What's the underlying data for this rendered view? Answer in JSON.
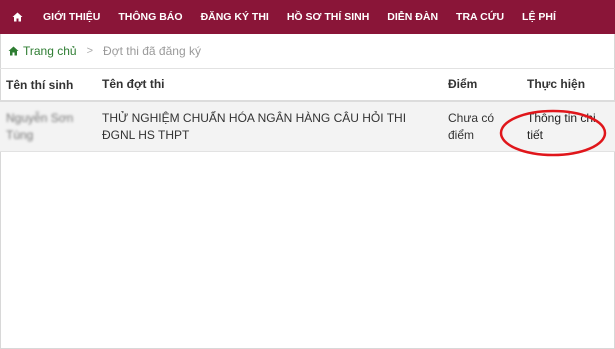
{
  "nav": {
    "home_icon": "home-icon",
    "items": [
      "GIỚI THIỆU",
      "THÔNG BÁO",
      "ĐĂNG KÝ THI",
      "HỒ SƠ THÍ SINH",
      "DIỄN ĐÀN",
      "TRA CỨU",
      "LỆ PHÍ"
    ],
    "color": "#8a1538"
  },
  "breadcrumb": {
    "home_label": "Trang chủ",
    "separator": ">",
    "current": "Đợt thi đã đăng ký"
  },
  "table": {
    "headers": [
      "Tên thí sinh",
      "Tên đợt thi",
      "Điểm",
      "Thực hiện"
    ],
    "rows": [
      {
        "candidate": "Nguyễn Sơn Tùng",
        "exam": "THỬ NGHIỆM CHUẨN HÓA NGÂN HÀNG CÂU HỎI THI ĐGNL HS THPT",
        "score": "Chưa có điểm",
        "action": "Thông tin chi tiết"
      }
    ]
  },
  "annotation_color": "#e0161b"
}
